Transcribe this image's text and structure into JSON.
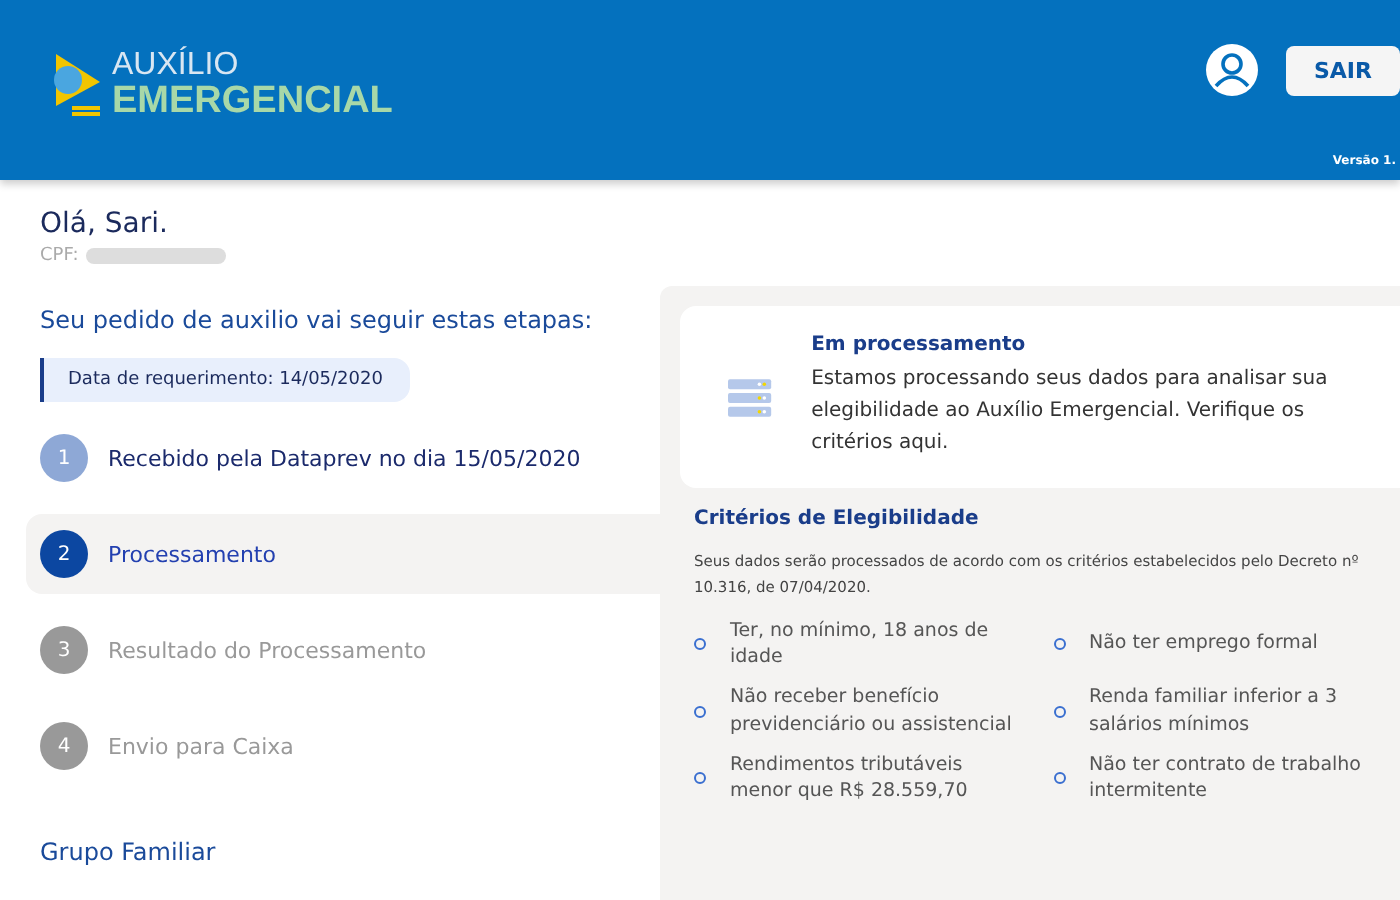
{
  "header": {
    "logo_top": "AUXÍLIO",
    "logo_bottom": "EMERGENCIAL",
    "logout": "SAIR",
    "version": "Versão 1."
  },
  "greeting": {
    "title": "Olá, Sari.",
    "cpf_label": "CPF:"
  },
  "steps": {
    "title": "Seu pedido de auxilio vai seguir estas etapas:",
    "request_date": "Data de requerimento: 14/05/2020",
    "items": [
      {
        "number": "1",
        "label": "Recebido pela Dataprev no dia 15/05/2020",
        "kind": "done",
        "selected": false
      },
      {
        "number": "2",
        "label": "Processamento",
        "kind": "current",
        "selected": true
      },
      {
        "number": "3",
        "label": "Resultado do Processamento",
        "kind": "pending",
        "selected": false
      },
      {
        "number": "4",
        "label": "Envio para Caixa",
        "kind": "pending",
        "selected": false
      }
    ]
  },
  "family": {
    "title": "Grupo Familiar"
  },
  "status_card": {
    "title": "Em processamento",
    "text": "Estamos processando seus dados para analisar sua elegibilidade ao Auxílio Emergencial. Verifique os critérios aqui."
  },
  "criteria": {
    "title": "Critérios de Elegibilidade",
    "intro": "Seus dados serão processados de acordo com os critérios estabelecidos pelo Decreto nº 10.316, de 07/04/2020.",
    "items": [
      "Ter, no mínimo, 18 anos de idade",
      "Não ter emprego formal",
      "Não receber benefício previdenciário ou assistencial",
      "Renda familiar inferior a 3 salários mínimos",
      "Rendimentos tributáveis menor que R$ 28.559,70",
      "Não ter contrato de trabalho intermitente"
    ]
  }
}
